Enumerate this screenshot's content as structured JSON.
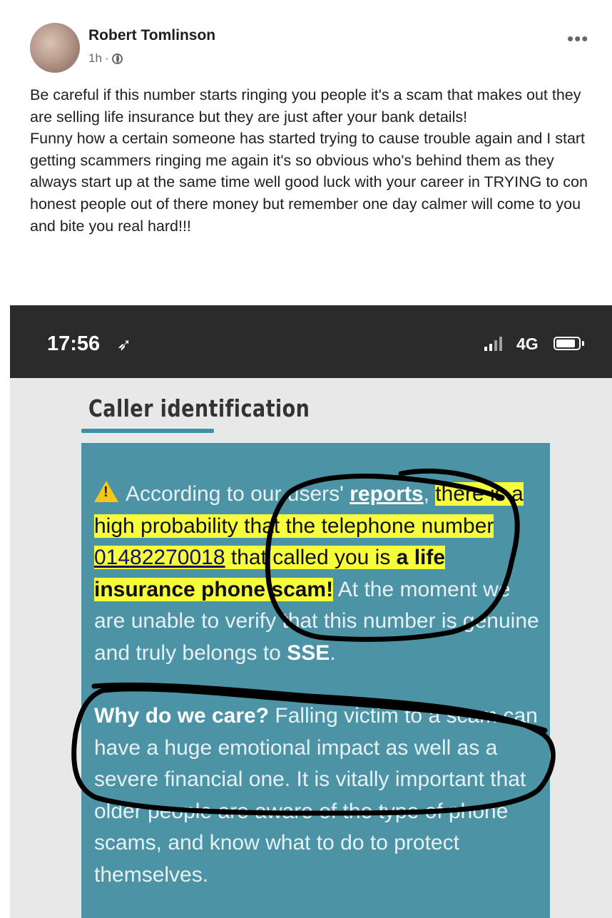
{
  "post": {
    "author": "Robert Tomlinson",
    "time": "1h",
    "separator": "·",
    "more_label": "•••",
    "avatar_icon": "profile-photo",
    "privacy_icon": "globe-icon",
    "text_p1": "Be careful if this number starts ringing you people it's a scam that makes out they are selling life insurance but they are just after your bank details!",
    "text_p2": "Funny how a certain someone has started trying to cause trouble again and I start getting scammers ringing me again it's so obvious who's behind them as they always start up at the same time well good luck with your career in TRYING to con honest people out of there money but remember one day calmer will come to you and bite you real hard!!!"
  },
  "screenshot": {
    "status_bar": {
      "time": "17:56",
      "location_icon": "location-arrow-icon",
      "network": "4G",
      "signal_icon": "signal-bars-icon",
      "battery_icon": "battery-icon"
    },
    "title": "Caller identification",
    "card": {
      "warning_icon": "warning-triangle-icon",
      "p1_intro": "According to our users' ",
      "p1_link": "reports",
      "p1_comma": ", ",
      "p1_hl1": "there is a high probability that the telephone number ",
      "p1_phone": "01482270018",
      "p1_hl2": " that called you is ",
      "p1_scam": "a life insurance phone scam!",
      "p1_rest": " At the moment we are unable to verify that this number is genuine and truly belongs to ",
      "p1_company": "SSE",
      "p1_end": ".",
      "p2_bold": "Why do we care?",
      "p2_rest": " Falling victim to a scam can have a huge emotional impact as well as a severe financial one. It is vitally important that older people are aware of the type of phone scams, and know what to do to protect themselves."
    },
    "colors": {
      "card_bg": "#4b93a5",
      "highlight": "#f7ff3c",
      "status_bar": "#2b2b2b",
      "underline_accent": "#3c91a6",
      "pen": "#000000"
    }
  }
}
